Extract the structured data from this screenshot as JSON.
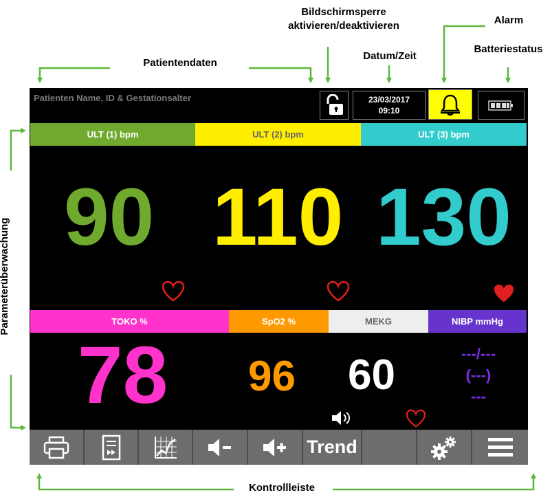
{
  "annotations": {
    "bildschirmsperre": "Bildschirmsperre\naktivieren/deaktivieren",
    "alarm": "Alarm",
    "datum_zeit": "Datum/Zeit",
    "batteriestatus": "Batteriestatus",
    "patientendaten": "Patientendaten",
    "parameterueberwachung": "Parameterüberwachung",
    "kontrollleiste": "Kontrollleiste"
  },
  "topbar": {
    "patient_placeholder": "Patienten Name, ID & Gestationsalter",
    "date": "23/03/2017",
    "time": "09:10",
    "lock_icon": "unlocked-padlock-icon",
    "alarm_icon": "bell-icon",
    "battery_icon": "battery-full-icon",
    "alarm_color": "#ffff00"
  },
  "ultrasound": [
    {
      "label": "ULT (1) bpm",
      "value": "90",
      "color": "#6faa2e",
      "heart": "outline"
    },
    {
      "label": "ULT (2) bpm",
      "value": "110",
      "color": "#ffee00",
      "heart": "outline"
    },
    {
      "label": "ULT (3) bpm",
      "value": "130",
      "color": "#33cccc",
      "heart": "filled"
    }
  ],
  "parameters": {
    "toko": {
      "label": "TOKO %",
      "value": "78",
      "color": "#ff33cc"
    },
    "spo2": {
      "label": "SpO2 %",
      "value": "96",
      "color": "#ff9900"
    },
    "mekg": {
      "label": "MEKG",
      "value": "60",
      "color": "#eeeeee"
    },
    "nibp": {
      "label": "NIBP mmHg",
      "line1": "---/---",
      "line2": "(---)",
      "line3": "---",
      "color": "#6633cc",
      "text_color": "#7a2ee6"
    }
  },
  "controls": {
    "print": "printer-icon",
    "report": "report-icon",
    "chart": "chart-icon",
    "vol_down": "volume-down-icon",
    "vol_up": "volume-up-icon",
    "trend_label": "Trend",
    "blank": "",
    "settings": "gears-icon",
    "menu": "menu-icon"
  }
}
